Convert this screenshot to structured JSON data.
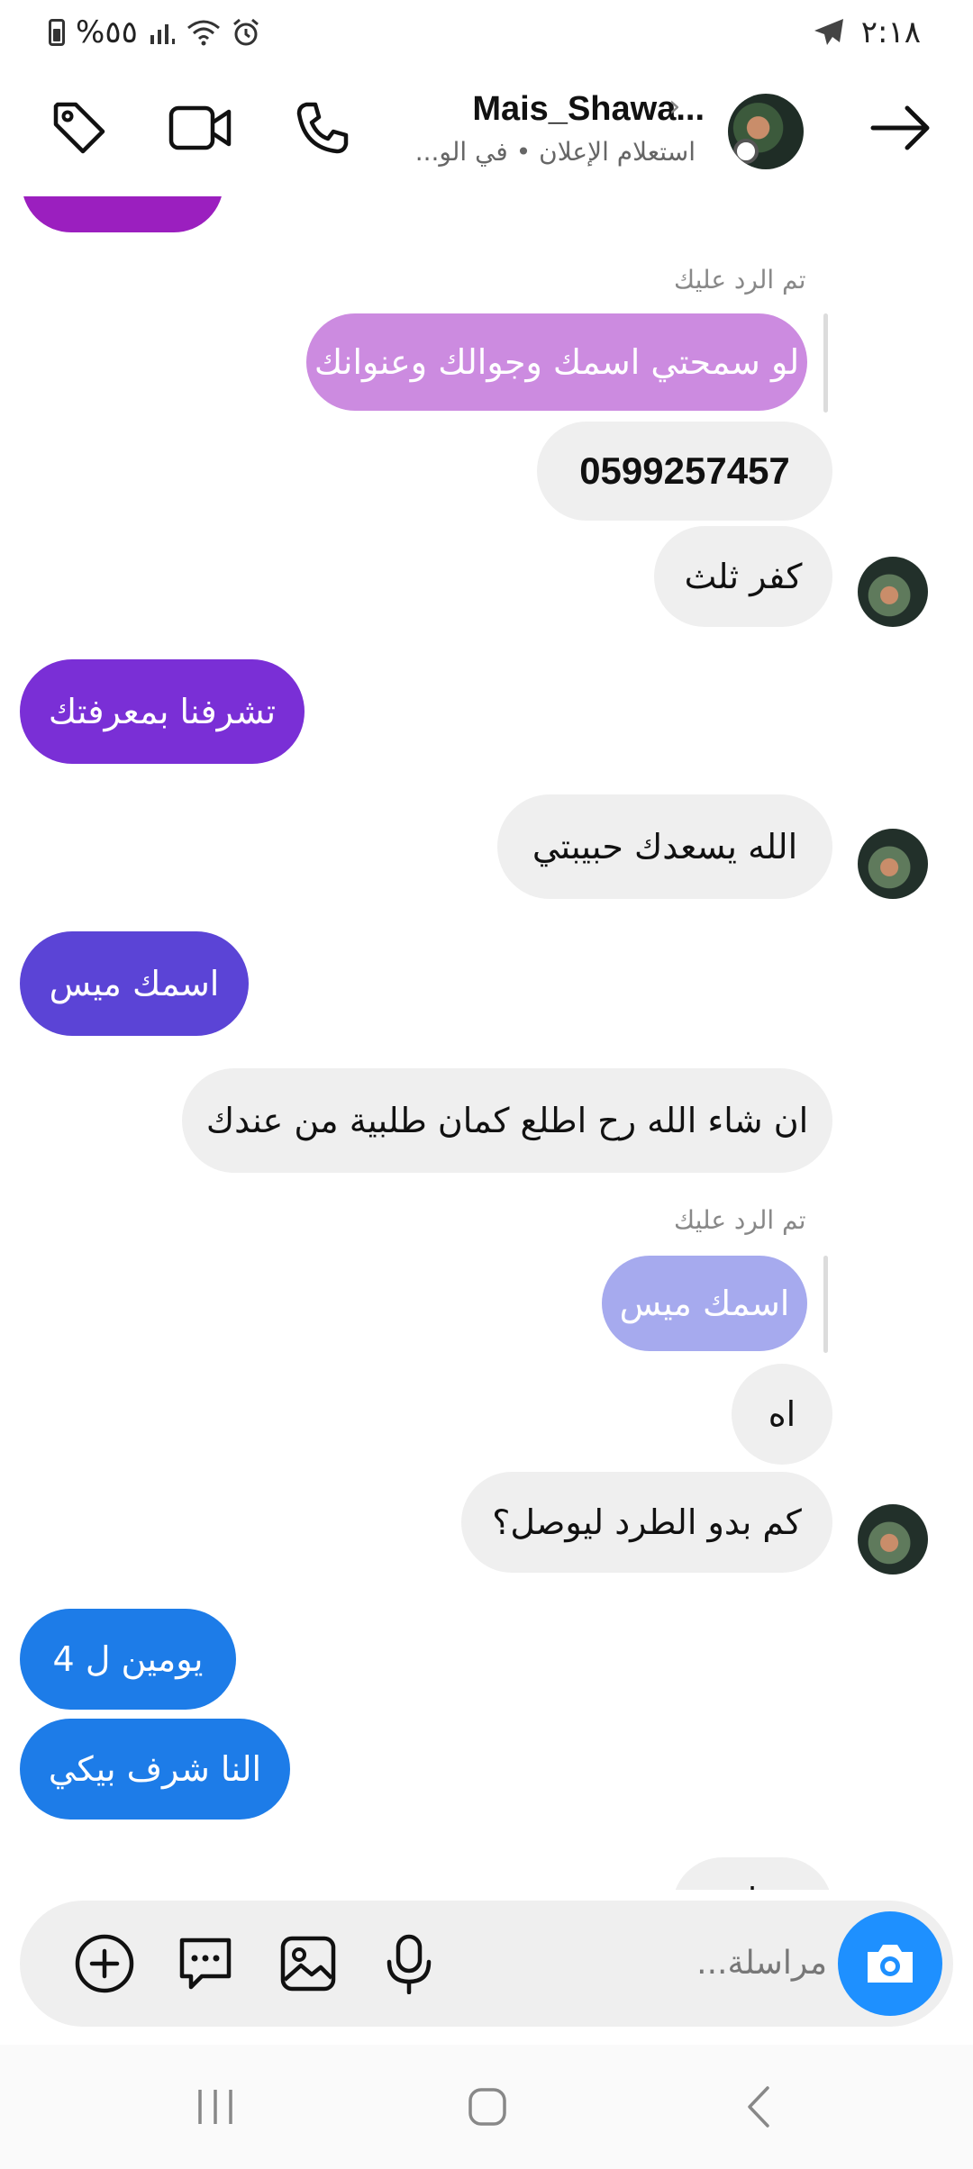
{
  "status_bar": {
    "time": "٢:١٨",
    "battery_text": "%٥٥",
    "signal_icon": "signal-icon",
    "wifi_icon": "wifi-icon",
    "alarm_icon": "alarm-icon",
    "telegram_icon": "telegram-icon"
  },
  "header": {
    "title": "Mais_Shawa...",
    "subtitle": "استعلام الإعلان • في الو...",
    "icons": [
      "back-arrow-icon",
      "phone-icon",
      "video-icon",
      "tag-icon"
    ]
  },
  "messages": {
    "reply_label": "تم الرد عليك",
    "m1_quoted": "لو سمحتي اسمك  وجوالك وعنوانك",
    "m2": "0599257457",
    "m3": "كفر ثلث",
    "m4": "تشرفنا بمعرفتك",
    "m5": "الله يسعدك حبيبتي",
    "m6": "اسمك ميس",
    "m7": "ان شاء الله رح اطلع كمان طلبية من عندك",
    "m8_reply_label": "تم الرد عليك",
    "m8_quoted": "اسمك ميس",
    "m9": "اه",
    "m10": "كم بدو الطرد ليوصل؟",
    "m11": "يومين ل 4",
    "m12": "النا شرف بيكي",
    "m13": "ا"
  },
  "composer": {
    "placeholder": "مراسلة...",
    "icons": [
      "camera-icon",
      "mic-icon",
      "gallery-icon",
      "sticker-icon",
      "plus-icon"
    ]
  },
  "colors": {
    "purple_dark": "#9b1fbf",
    "violet": "#7a2fd6",
    "indigo": "#5b44d6",
    "blue": "#1d7ce8",
    "lilac_quote": "#cc8be0",
    "periwinkle_quote": "#a6aaee",
    "camera_blue": "#1e90ff"
  }
}
